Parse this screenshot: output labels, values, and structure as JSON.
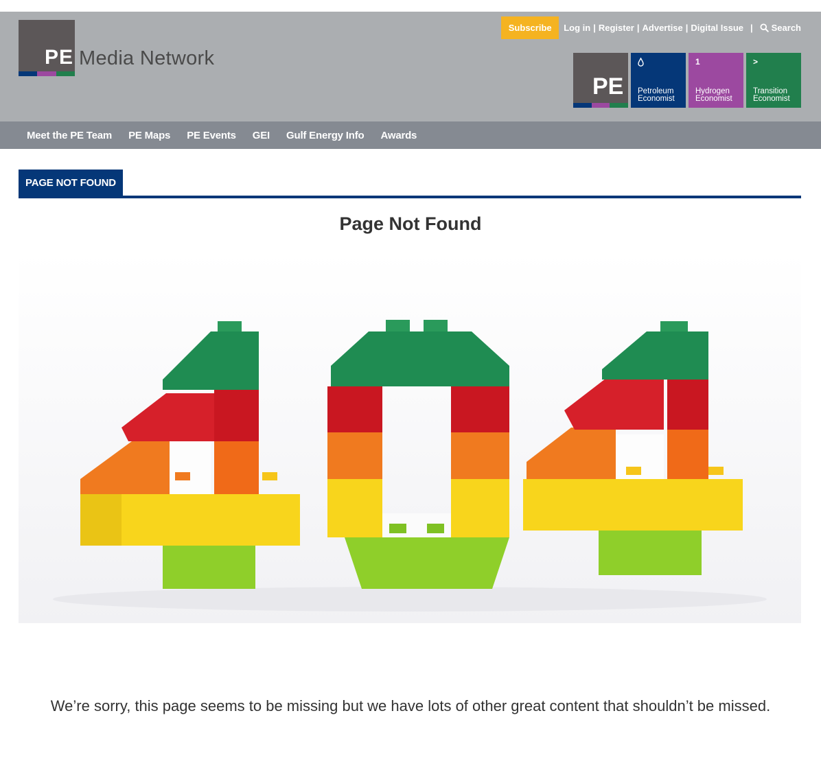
{
  "site": {
    "logo_text": "PE",
    "logo_name": "Media Network",
    "logo_stripe_colors": [
      "#053778",
      "#9c49a0",
      "#217f4d"
    ]
  },
  "utility": {
    "subscribe": "Subscribe",
    "links": [
      "Log in",
      "Register",
      "Advertise",
      "Digital Issue"
    ],
    "search": "Search"
  },
  "brands": {
    "pe": "PE",
    "petroleum": {
      "glyph": "💧",
      "line1": "Petroleum",
      "line2": "Economist",
      "color": "#053778"
    },
    "hydrogen": {
      "glyph": "1",
      "line1": "Hydrogen",
      "line2": "Economist",
      "color": "#9c49a0"
    },
    "transition": {
      "glyph": ">",
      "line1": "Transition",
      "line2": "Economist",
      "color": "#217f4d"
    }
  },
  "nav": {
    "items": [
      "Meet the PE Team",
      "PE Maps",
      "PE Events",
      "GEI",
      "Gulf Energy Info",
      "Awards"
    ]
  },
  "section": {
    "tab": "PAGE NOT FOUND"
  },
  "main": {
    "title": "Page Not Found",
    "image_alt": "404",
    "message": "We’re sorry, this page seems to be missing but we have lots of other great content that shouldn’t be missed."
  }
}
